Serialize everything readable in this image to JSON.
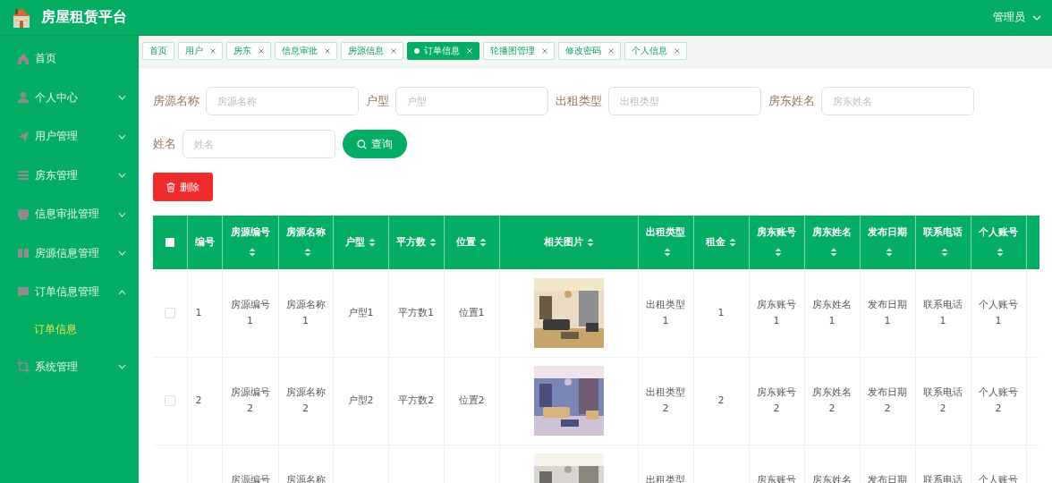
{
  "header": {
    "title": "房屋租赁平台",
    "user": "管理员"
  },
  "sidebar": {
    "items": [
      {
        "label": "首页",
        "kind": "link"
      },
      {
        "label": "个人中心",
        "kind": "menu",
        "expanded": false
      },
      {
        "label": "用户管理",
        "kind": "menu",
        "expanded": false
      },
      {
        "label": "房东管理",
        "kind": "menu",
        "expanded": false
      },
      {
        "label": "信息审批管理",
        "kind": "menu",
        "expanded": false
      },
      {
        "label": "房源信息管理",
        "kind": "menu",
        "expanded": false
      },
      {
        "label": "订单信息管理",
        "kind": "menu",
        "expanded": true,
        "children": [
          {
            "label": "订单信息",
            "selected": true
          }
        ]
      },
      {
        "label": "系统管理",
        "kind": "menu",
        "expanded": false
      }
    ]
  },
  "tabs": [
    {
      "label": "首页",
      "selected": false,
      "closable": false
    },
    {
      "label": "用户",
      "selected": false,
      "closable": true
    },
    {
      "label": "房东",
      "selected": false,
      "closable": true
    },
    {
      "label": "信息审批",
      "selected": false,
      "closable": true
    },
    {
      "label": "房源信息",
      "selected": false,
      "closable": true
    },
    {
      "label": "订单信息",
      "selected": true,
      "closable": true
    },
    {
      "label": "轮播图管理",
      "selected": false,
      "closable": true
    },
    {
      "label": "修改密码",
      "selected": false,
      "closable": true
    },
    {
      "label": "个人信息",
      "selected": false,
      "closable": true
    }
  ],
  "search": {
    "fields": [
      {
        "label": "房源名称",
        "placeholder": "房源名称"
      },
      {
        "label": "户型",
        "placeholder": "户型"
      },
      {
        "label": "出租类型",
        "placeholder": "出租类型"
      },
      {
        "label": "房东姓名",
        "placeholder": "房东姓名"
      },
      {
        "label": "姓名",
        "placeholder": "姓名"
      }
    ],
    "button": "查询"
  },
  "delete_button": "删除",
  "table": {
    "select_all": false,
    "columns": [
      {
        "label": "编号",
        "sortable": false
      },
      {
        "label": "房源编号",
        "sortable": true
      },
      {
        "label": "房源名称",
        "sortable": true
      },
      {
        "label": "户型",
        "sortable": true
      },
      {
        "label": "平方数",
        "sortable": true
      },
      {
        "label": "位置",
        "sortable": true
      },
      {
        "label": "相关图片",
        "sortable": true
      },
      {
        "label": "出租类型",
        "sortable": true
      },
      {
        "label": "租金",
        "sortable": true
      },
      {
        "label": "房东账号",
        "sortable": true
      },
      {
        "label": "房东姓名",
        "sortable": true
      },
      {
        "label": "发布日期",
        "sortable": true
      },
      {
        "label": "联系电话",
        "sortable": true
      },
      {
        "label": "个人账号",
        "sortable": true
      }
    ],
    "rows": [
      {
        "checked": false,
        "cells": [
          "1",
          "房源编号1",
          "房源名称1",
          "户型1",
          "平方数1",
          "位置1",
          {
            "kind": "picture"
          },
          "出租类型1",
          "1",
          "房东账号1",
          "房东姓名1",
          "发布日期1",
          "联系电话1",
          "个人账号1"
        ]
      },
      {
        "checked": false,
        "cells": [
          "2",
          "房源编号2",
          "房源名称2",
          "户型2",
          "平方数2",
          "位置2",
          {
            "kind": "picture"
          },
          "出租类型2",
          "2",
          "房东账号2",
          "房东姓名2",
          "发布日期2",
          "联系电话2",
          "个人账号2"
        ]
      },
      {
        "cells": [
          null,
          "房源编号",
          "房源名称",
          null,
          null,
          null,
          {
            "kind": "picture"
          },
          "出租类型",
          null,
          "房东账号",
          "房东姓名",
          "发布日期",
          "联系电话",
          "个人账号"
        ]
      }
    ]
  }
}
